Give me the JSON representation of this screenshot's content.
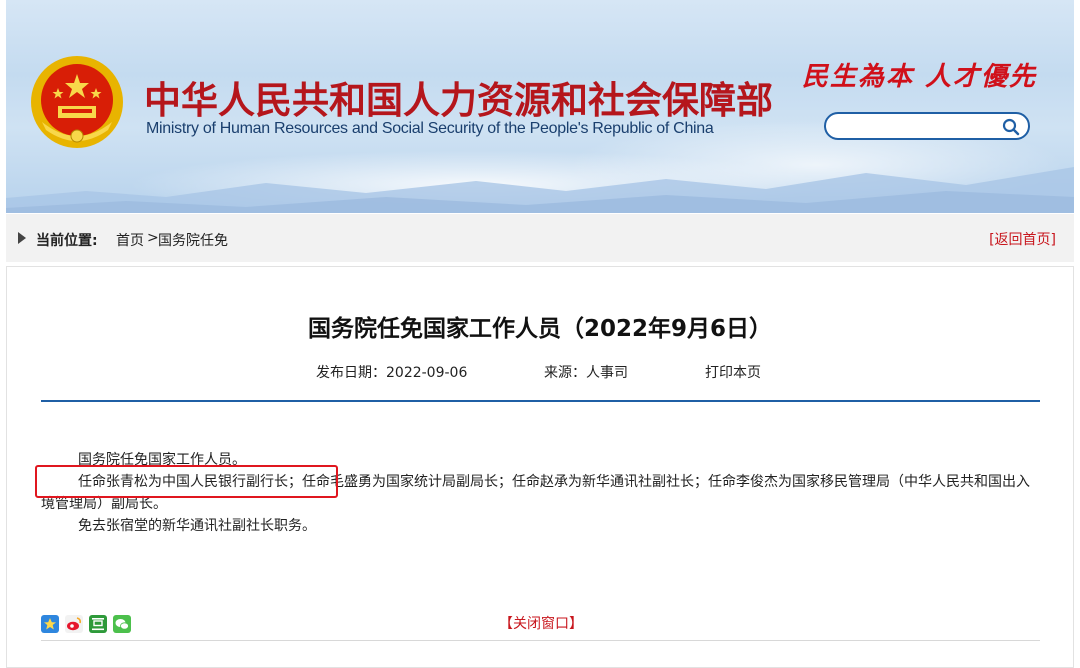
{
  "header": {
    "title_cn": "中华人民共和国人力资源和社会保障部",
    "title_en": "Ministry of Human Resources and Social Security of the People's Republic of China",
    "slogan": "民生為本 人才優先",
    "search": {
      "value": "",
      "placeholder": ""
    }
  },
  "breadcrumb": {
    "label": "当前位置:",
    "home": "首页",
    "separator": ">",
    "current": "国务院任免",
    "return_link": "[返回首页]"
  },
  "article": {
    "title": "国务院任免国家工作人员（2022年9月6日）",
    "date": "发布日期：2022-09-06",
    "source": "来源：人事司",
    "print": "打印本页",
    "paragraph_1": "国务院任免国家工作人员。",
    "paragraph_2_highlight": "任命张青松为中国人民银行副行长",
    "paragraph_2_rest": "；任命毛盛勇为国家统计局副局长；任命赵承为新华通讯社副社长；任命李俊杰为国家移民管理局（中华人民共和国出入境管理局）副局长。",
    "paragraph_3": "免去张宿堂的新华通讯社副社长职务。",
    "close_window": "【关闭窗口】"
  },
  "colors": {
    "brand_red": "#b5161c",
    "link_red": "#c8161d",
    "accent_blue": "#1f5fa5",
    "highlight_box": "#e0161f"
  },
  "icons": [
    "national-emblem",
    "search-icon",
    "qzone-icon",
    "weibo-icon",
    "douban-icon",
    "wechat-icon"
  ]
}
